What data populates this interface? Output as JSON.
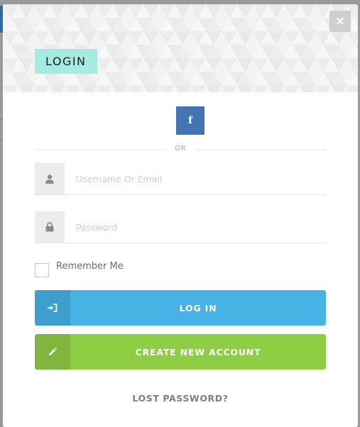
{
  "modal": {
    "title": "LOGIN",
    "close_symbol": "×",
    "close_icon": "close-icon"
  },
  "social": {
    "facebook_letter": "f",
    "facebook_icon": "facebook-icon"
  },
  "divider_text": "OR",
  "form": {
    "username": {
      "placeholder": "Username Or Email",
      "value": "",
      "icon": "user-icon"
    },
    "password": {
      "placeholder": "Password",
      "value": "",
      "icon": "lock-icon"
    },
    "remember_label": "Remember Me",
    "remember_checked": false
  },
  "buttons": {
    "login_label": "LOG IN",
    "login_icon": "sign-in-icon",
    "create_label": "CREATE NEW ACCOUNT",
    "create_icon": "pencil-icon"
  },
  "lost_password": "LOST PASSWORD?",
  "colors": {
    "title_badge": "#a4ebe2",
    "facebook": "#4375b3",
    "login": "#47b3e5",
    "create": "#8ece45"
  }
}
